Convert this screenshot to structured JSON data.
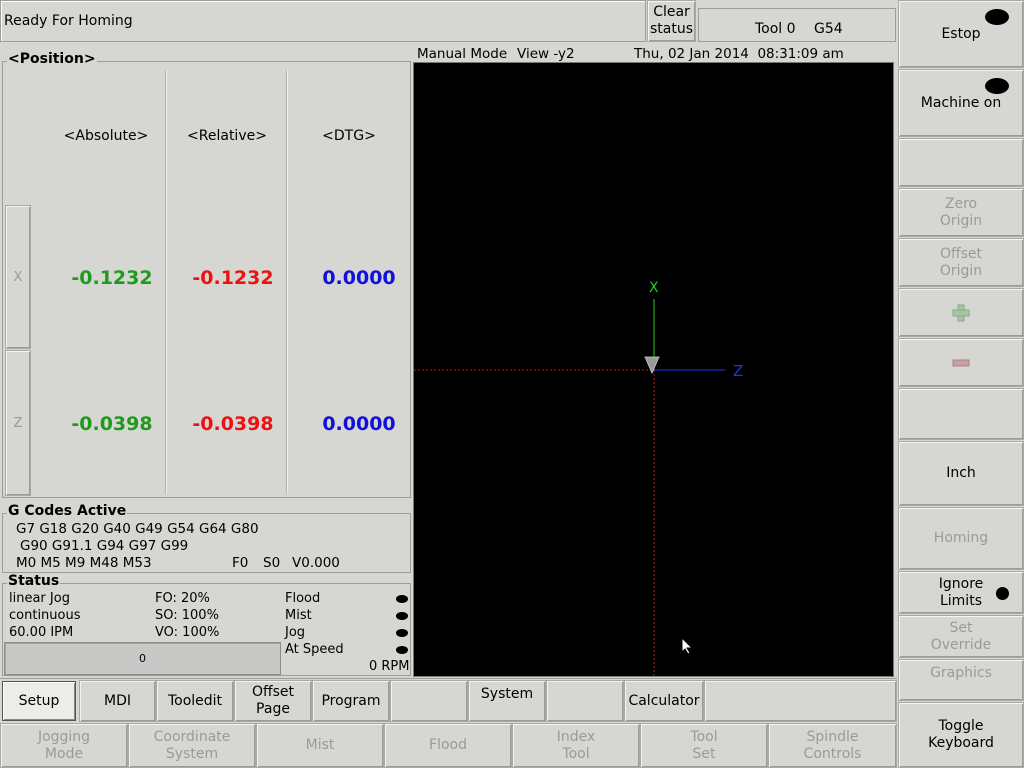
{
  "status_bar": {
    "message": "Ready For Homing"
  },
  "clear_status": {
    "label": "Clear\nstatus"
  },
  "tool_info": {
    "tool": "Tool 0",
    "work_offset": "G54"
  },
  "right_panel": [
    {
      "label": "Estop",
      "enabled": true,
      "led": true
    },
    {
      "label": "Machine on",
      "enabled": true,
      "led": true
    },
    {
      "label": "",
      "enabled": true
    },
    {
      "label": "Zero\nOrigin",
      "enabled": false
    },
    {
      "label": "Offset\nOrigin",
      "enabled": false
    },
    {
      "label": "",
      "icon": "plus-icon"
    },
    {
      "label": "",
      "icon": "minus-icon"
    },
    {
      "label": "",
      "enabled": true
    },
    {
      "label": "Inch",
      "enabled": true
    },
    {
      "label": "Homing",
      "enabled": false
    },
    {
      "label": "Ignore\nLimits",
      "enabled": true,
      "led": true
    },
    {
      "label": "Set\nOverride",
      "enabled": false
    },
    {
      "label": "Graphics",
      "enabled": false
    },
    {
      "label": "Toggle\nKeyboard",
      "enabled": true
    }
  ],
  "position": {
    "title": "<Position>",
    "headers": [
      "<Absolute>",
      "<Relative>",
      "<DTG>"
    ],
    "axes": [
      {
        "label": "X",
        "absolute": "-0.1232",
        "relative": "-0.1232",
        "dtg": "0.0000"
      },
      {
        "label": "Z",
        "absolute": "-0.0398",
        "relative": "-0.0398",
        "dtg": "0.0000"
      }
    ],
    "colors": {
      "absolute": "#1f9a1f",
      "relative": "#ee1111",
      "dtg": "#1111dd"
    }
  },
  "view": {
    "mode": "Manual Mode",
    "view": "View -y2",
    "datetime": "Thu, 02 Jan 2014  08:31:09 am",
    "axis_x_label": "X",
    "axis_z_label": "Z"
  },
  "gcodes": {
    "title": "G Codes Active",
    "line1": "G7 G18 G20 G40 G49 G54 G64 G80",
    "line2": "G90 G91.1 G94 G97 G99",
    "line3": "M0 M5 M9 M48 M53",
    "feed": "F0",
    "speed": "S0",
    "velocity": "V0.000"
  },
  "status": {
    "title": "Status",
    "col1": [
      "linear Jog",
      "continuous",
      "60.00 IPM"
    ],
    "col2": [
      "FO: 20%",
      "SO: 100%",
      "VO: 100%"
    ],
    "col3": [
      "Flood",
      "Mist",
      "Jog",
      "At Speed"
    ],
    "progress": "0",
    "rpm": "0 RPM"
  },
  "bottom_row1": [
    {
      "label": "Setup",
      "active": true
    },
    {
      "label": "MDI"
    },
    {
      "label": "Tooledit"
    },
    {
      "label": "Offset\nPage"
    },
    {
      "label": "Program"
    },
    {
      "label": ""
    },
    {
      "label": "System"
    },
    {
      "label": ""
    },
    {
      "label": "Calculator"
    }
  ],
  "bottom_row2": [
    {
      "label": "Jogging\nMode"
    },
    {
      "label": "Coordinate\nSystem"
    },
    {
      "label": "Mist"
    },
    {
      "label": "Flood"
    },
    {
      "label": "Index\nTool"
    },
    {
      "label": "Tool\nSet"
    },
    {
      "label": "Spindle\nControls"
    }
  ]
}
